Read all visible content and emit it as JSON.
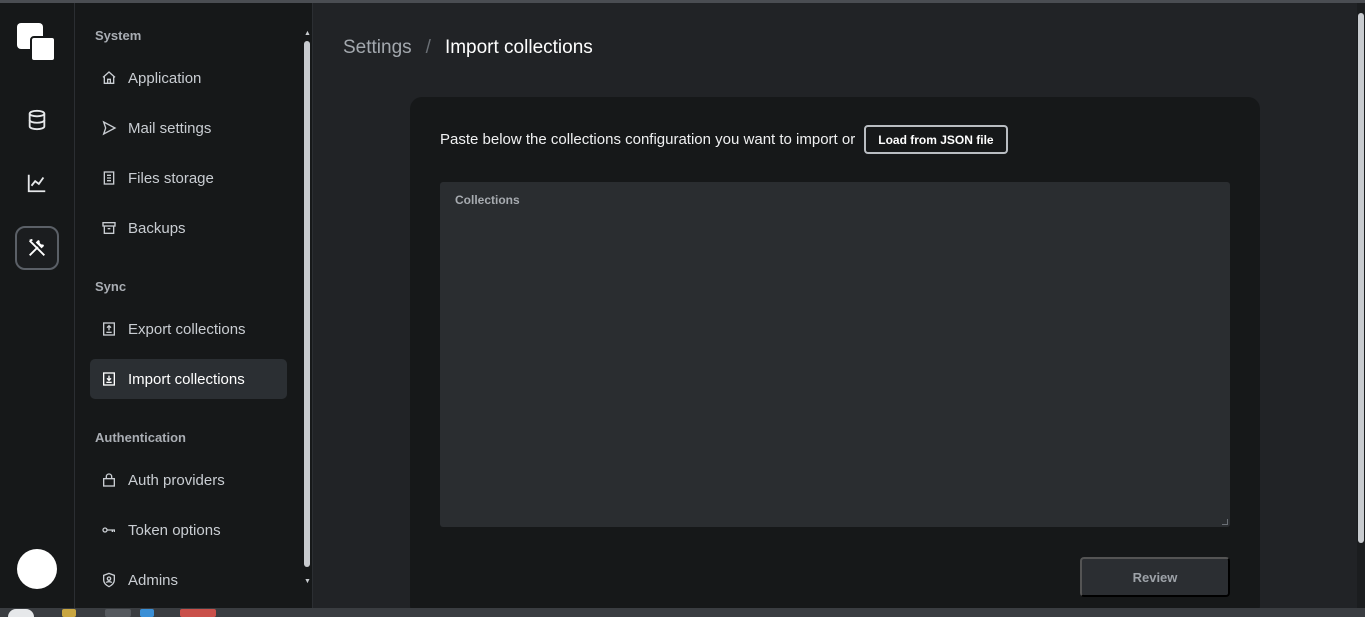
{
  "rail": {
    "items": [
      {
        "name": "collections",
        "icon": "database-icon"
      },
      {
        "name": "logs",
        "icon": "chart-line-icon"
      },
      {
        "name": "settings",
        "icon": "tools-icon",
        "active": true
      }
    ]
  },
  "sidebar": {
    "sections": [
      {
        "title": "System",
        "items": [
          {
            "label": "Application",
            "icon": "home-icon"
          },
          {
            "label": "Mail settings",
            "icon": "send-icon"
          },
          {
            "label": "Files storage",
            "icon": "storage-icon"
          },
          {
            "label": "Backups",
            "icon": "archive-icon"
          }
        ]
      },
      {
        "title": "Sync",
        "items": [
          {
            "label": "Export collections",
            "icon": "upload-icon"
          },
          {
            "label": "Import collections",
            "icon": "download-icon",
            "active": true
          }
        ]
      },
      {
        "title": "Authentication",
        "items": [
          {
            "label": "Auth providers",
            "icon": "lock-icon"
          },
          {
            "label": "Token options",
            "icon": "key-icon"
          },
          {
            "label": "Admins",
            "icon": "shield-user-icon"
          }
        ]
      }
    ]
  },
  "breadcrumb": {
    "parent": "Settings",
    "separator": "/",
    "current": "Import collections"
  },
  "import": {
    "intro_text": "Paste below the collections configuration you want to import or",
    "load_button": "Load from JSON file",
    "textarea_label": "Collections",
    "textarea_value": "",
    "review_button": "Review"
  },
  "colors": {
    "background": "#212326",
    "panel": "#161819",
    "active_item": "#2b2f33"
  }
}
